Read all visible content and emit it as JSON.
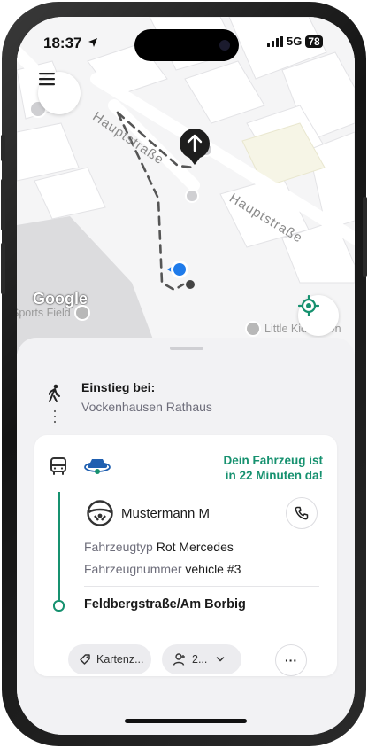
{
  "status_bar": {
    "time": "18:37",
    "network": "5G",
    "battery": "78"
  },
  "map": {
    "street_name_upper": "Hauptstraße",
    "street_name_lower": "Hauptstraße",
    "attribution": "Google",
    "poi_left": "Sports Field",
    "poi_right": "Little Kids Town"
  },
  "boarding": {
    "label": "Einstieg bei:",
    "stop": "Vockenhausen Rathaus"
  },
  "vehicle_card": {
    "eta_line1": "Dein Fahrzeug ist",
    "eta_line2": "in 22 Minuten da!",
    "driver_name": "Mustermann M",
    "type_label": "Fahrzeugtyp",
    "type_value": "Rot Mercedes",
    "number_label": "Fahrzeugnummer",
    "number_value": "vehicle #3",
    "destination": "Feldbergstraße/Am Borbig",
    "actions": {
      "card_button": "Kartenz...",
      "passenger_button": "2...",
      "more_button": "···"
    }
  },
  "colors": {
    "accent": "#16916f",
    "text": "#1a1a1a",
    "muted": "#6d6d7a",
    "map_blue": "#1f7bea"
  }
}
